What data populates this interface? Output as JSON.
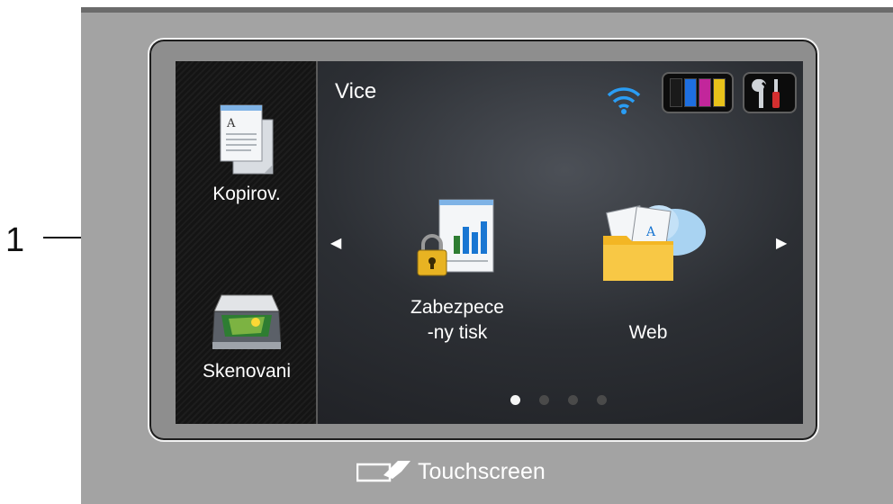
{
  "callout": {
    "number": "1"
  },
  "screen": {
    "title": "Vice",
    "sidebar": {
      "items": [
        {
          "label": "Kopirov.",
          "icon": "copy-document-icon"
        },
        {
          "label": "Skenovani",
          "icon": "scanner-icon"
        }
      ]
    },
    "status": {
      "wifi_icon": "wifi-icon",
      "ink_colors": [
        "#1a1a1a",
        "#1e6fe0",
        "#c2269b",
        "#e8c21a"
      ],
      "tools_icon": "wrench-screwdriver-icon"
    },
    "apps": [
      {
        "label_line1": "Zabezpece",
        "label_line2": "-ny tisk",
        "icon": "secure-print-icon"
      },
      {
        "label_line1": "Web",
        "label_line2": "",
        "icon": "web-folder-cloud-icon"
      }
    ],
    "page_indicator": {
      "total": 4,
      "active": 1
    }
  },
  "brand": {
    "text": "Touchscreen",
    "icon": "touchscreen-logo-icon"
  }
}
